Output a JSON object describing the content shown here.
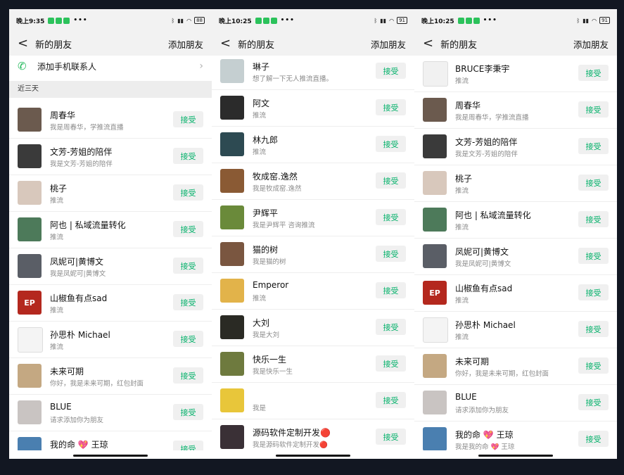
{
  "panels": [
    {
      "status": {
        "time": "晚上9:35",
        "battery": "88"
      },
      "nav": {
        "back": "<",
        "title": "新的朋友",
        "action": "添加朋友"
      },
      "add_contacts_label": "添加手机联系人",
      "section_label": "近三天",
      "accept_label": "接受",
      "rows": [
        {
          "name": "周春华",
          "sub": "我是周春华，学推流直播",
          "avatar_color": "#6b5a4e",
          "avatar_text": ""
        },
        {
          "name": "文芳-芳姐的陪伴",
          "sub": "我是文芳-芳姐的陪伴",
          "avatar_color": "#3a3a3a",
          "avatar_text": ""
        },
        {
          "name": "桃子",
          "sub": "推流",
          "avatar_color": "#d8c8bc",
          "avatar_text": ""
        },
        {
          "name": "阿也 | 私域流量转化",
          "sub": "推流",
          "avatar_color": "#4d7a5a",
          "avatar_text": ""
        },
        {
          "name": "凤妮可|黄博文",
          "sub": "我是凤妮可|黄博文",
          "avatar_color": "#5a5e66",
          "avatar_text": ""
        },
        {
          "name": "山椒鱼有点sad",
          "sub": "推流",
          "avatar_color": "#b4281e",
          "avatar_text": "EP"
        },
        {
          "name": "孙思朴 Michael",
          "sub": "推流",
          "avatar_color": "#f4f4f4",
          "avatar_text": ""
        },
        {
          "name": "未来可期",
          "sub": "你好，我是未来可期，红包封面",
          "avatar_color": "#c4a882",
          "avatar_text": ""
        },
        {
          "name": "BLUE",
          "sub": "请求添加你为朋友",
          "avatar_color": "#c9c4c2",
          "avatar_text": ""
        },
        {
          "name": "我的命 💖 王琼",
          "sub": "我是我的命 💖 王琼",
          "avatar_color": "#4a7fb0",
          "avatar_text": ""
        }
      ]
    },
    {
      "status": {
        "time": "晚上10:25",
        "battery": "91"
      },
      "nav": {
        "back": "<",
        "title": "新的朋友",
        "action": "添加朋友"
      },
      "accept_label": "接受",
      "rows": [
        {
          "name": "琳子",
          "sub": "想了解一下无人推流直播。",
          "avatar_color": "#c5cfd1",
          "avatar_text": ""
        },
        {
          "name": "阿文",
          "sub": "推流",
          "avatar_color": "#2b2b2b",
          "avatar_text": ""
        },
        {
          "name": "林九郎",
          "sub": "推流",
          "avatar_color": "#2d4a52",
          "avatar_text": ""
        },
        {
          "name": "牧成窑.逸然",
          "sub": "我是牧成窑.逸然",
          "avatar_color": "#8a5a34",
          "avatar_text": ""
        },
        {
          "name": "尹辉平",
          "sub": "我是尹辉平 咨询推流",
          "avatar_color": "#6a8a3a",
          "avatar_text": ""
        },
        {
          "name": "猫的树",
          "sub": "我是猫的树",
          "avatar_color": "#7a5640",
          "avatar_text": ""
        },
        {
          "name": "Emperor",
          "sub": "推流",
          "avatar_color": "#e2b34a",
          "avatar_text": ""
        },
        {
          "name": "大刘",
          "sub": "我是大刘",
          "avatar_color": "#2a2a24",
          "avatar_text": ""
        },
        {
          "name": "快乐一生",
          "sub": "我是快乐一生",
          "avatar_color": "#6e7a3e",
          "avatar_text": ""
        },
        {
          "name": "",
          "sub": "我是",
          "avatar_color": "#e8c63a",
          "avatar_text": ""
        },
        {
          "name": "源码软件定制开发🔴",
          "sub": "我是源码软件定制开发🔴",
          "avatar_color": "#3a3036",
          "avatar_text": ""
        }
      ]
    },
    {
      "status": {
        "time": "晚上10:25",
        "battery": "91"
      },
      "nav": {
        "back": "<",
        "title": "新的朋友",
        "action": "添加朋友"
      },
      "accept_label": "接受",
      "rows": [
        {
          "name": "BRUCE李秉宇",
          "sub": "推流",
          "avatar_color": "#f1f1f1",
          "avatar_text": ""
        },
        {
          "name": "周春华",
          "sub": "我是周春华，学推流直播",
          "avatar_color": "#6b5a4e",
          "avatar_text": ""
        },
        {
          "name": "文芳-芳姐的陪伴",
          "sub": "我是文芳-芳姐的陪伴",
          "avatar_color": "#3a3a3a",
          "avatar_text": ""
        },
        {
          "name": "桃子",
          "sub": "推流",
          "avatar_color": "#d8c8bc",
          "avatar_text": ""
        },
        {
          "name": "阿也 | 私域流量转化",
          "sub": "推流",
          "avatar_color": "#4d7a5a",
          "avatar_text": ""
        },
        {
          "name": "凤妮可|黄博文",
          "sub": "我是凤妮可|黄博文",
          "avatar_color": "#5a5e66",
          "avatar_text": ""
        },
        {
          "name": "山椒鱼有点sad",
          "sub": "推流",
          "avatar_color": "#b4281e",
          "avatar_text": "EP"
        },
        {
          "name": "孙思朴 Michael",
          "sub": "推流",
          "avatar_color": "#f4f4f4",
          "avatar_text": ""
        },
        {
          "name": "未来可期",
          "sub": "你好，我是未来可期，红包封面",
          "avatar_color": "#c4a882",
          "avatar_text": ""
        },
        {
          "name": "BLUE",
          "sub": "请求添加你为朋友",
          "avatar_color": "#c9c4c2",
          "avatar_text": ""
        },
        {
          "name": "我的命 💖 王琼",
          "sub": "我是我的命 💖 王琼",
          "avatar_color": "#4a7fb0",
          "avatar_text": ""
        }
      ]
    }
  ]
}
